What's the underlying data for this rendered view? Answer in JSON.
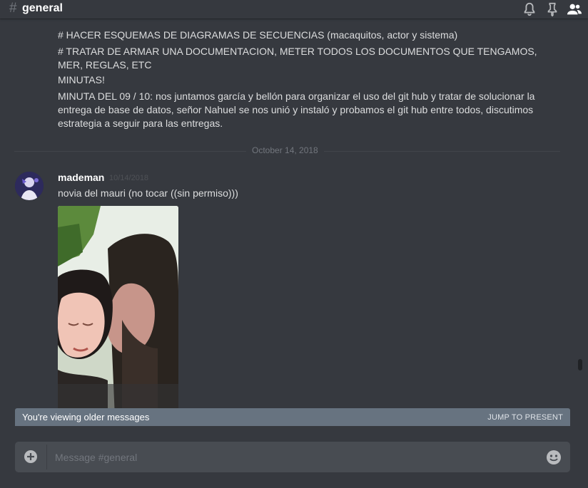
{
  "header": {
    "hash": "#",
    "channel": "general",
    "icons": [
      "bell-icon",
      "pin-icon",
      "members-icon"
    ]
  },
  "messages": {
    "lines": [
      "# HACER ESQUEMAS DE DIAGRAMAS DE SECUENCIAS (macaquitos, actor y sistema)",
      "# TRATAR DE ARMAR UNA DOCUMENTACION, METER TODOS LOS DOCUMENTOS QUE TENGAMOS, MER, REGLAS, ETC",
      "MINUTAS!",
      "MINUTA DEL 09 / 10: nos juntamos garcía y bellón para organizar el uso del git hub y tratar de solucionar la entrega de base de datos, señor Nahuel se nos unió y instaló y probamos el git hub entre todos, discutimos estrategia a seguir para las entregas."
    ],
    "date_divider": "October 14, 2018",
    "post": {
      "author": "mademan",
      "timestamp": "10/14/2018",
      "text": "novia del mauri (no tocar ((sin permiso)))"
    }
  },
  "older_bar": {
    "text": "You're viewing older messages",
    "jump_label": "JUMP TO PRESENT"
  },
  "composer": {
    "placeholder": "Message #general",
    "value": ""
  },
  "colors": {
    "background": "#36393f",
    "older_bar": "#677380",
    "composer": "#484c52"
  }
}
